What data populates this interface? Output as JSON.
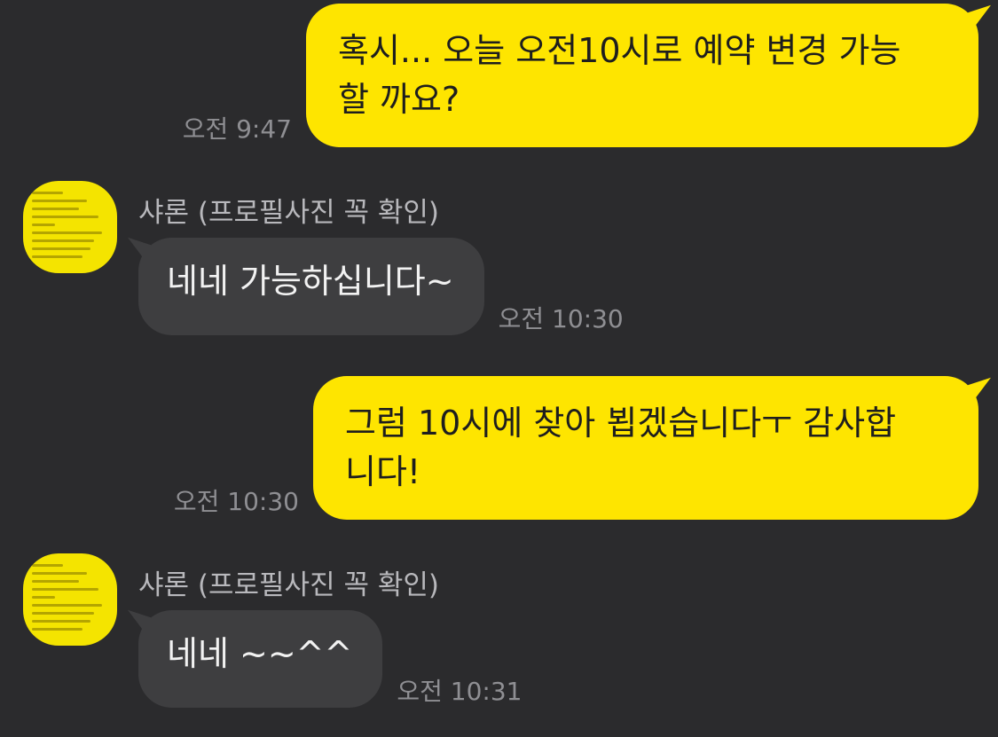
{
  "messages": [
    {
      "direction": "out",
      "text": "혹시... 오늘 오전10시로 예약 변경 가능\n할 까요?",
      "time": "오전 9:47"
    },
    {
      "direction": "in",
      "sender": "샤론 (프로필사진 꼭 확인)",
      "text": "네네 가능하십니다~",
      "time": "오전 10:30",
      "avatar_icon": "profile-notice-image"
    },
    {
      "direction": "out",
      "text": "그럼 10시에 찾아 뵙겠습니다ㅜ 감사합\n니다!",
      "time": "오전 10:30"
    },
    {
      "direction": "in",
      "sender": "샤론 (프로필사진 꼭 확인)",
      "text": "네네 ~~^^",
      "time": "오전 10:31",
      "avatar_icon": "profile-notice-image"
    }
  ],
  "colors": {
    "background": "#2b2b2d",
    "outgoing_bubble": "#fee500",
    "incoming_bubble": "#3e3e40",
    "timestamp": "#8f8f93",
    "avatar": "#f4e400"
  }
}
